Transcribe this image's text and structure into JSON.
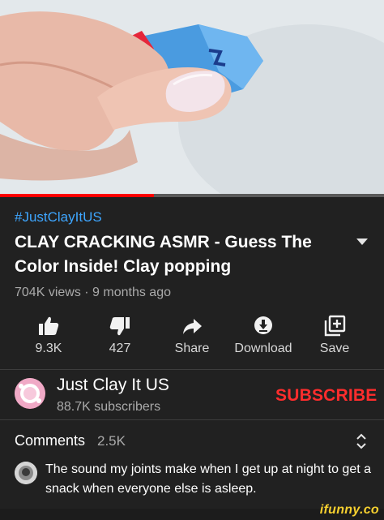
{
  "video": {
    "progress_fraction": 0.4
  },
  "info": {
    "hashtag": "#JustClayItUS",
    "title": "CLAY CRACKING ASMR - Guess The Color Inside! Clay popping",
    "meta": "704K views · 9 months ago"
  },
  "actions": [
    {
      "icon": "thumbs-up-icon",
      "label": "9.3K"
    },
    {
      "icon": "thumbs-down-icon",
      "label": "427"
    },
    {
      "icon": "share-icon",
      "label": "Share"
    },
    {
      "icon": "download-icon",
      "label": "Download"
    },
    {
      "icon": "save-playlist-icon",
      "label": "Save"
    }
  ],
  "channel": {
    "name": "Just Clay It US",
    "subscribers": "88.7K subscribers",
    "subscribe_label": "SUBSCRIBE"
  },
  "comments": {
    "label": "Comments",
    "count": "2.5K",
    "top_comment": "The sound my joints make when I get up at night to get a snack when everyone else is asleep."
  },
  "watermark": "ifunny.co",
  "colors": {
    "background": "#212121",
    "accent_red": "#ff0000",
    "link_blue": "#3ea6ff",
    "watermark_yellow": "#f6d02f"
  }
}
